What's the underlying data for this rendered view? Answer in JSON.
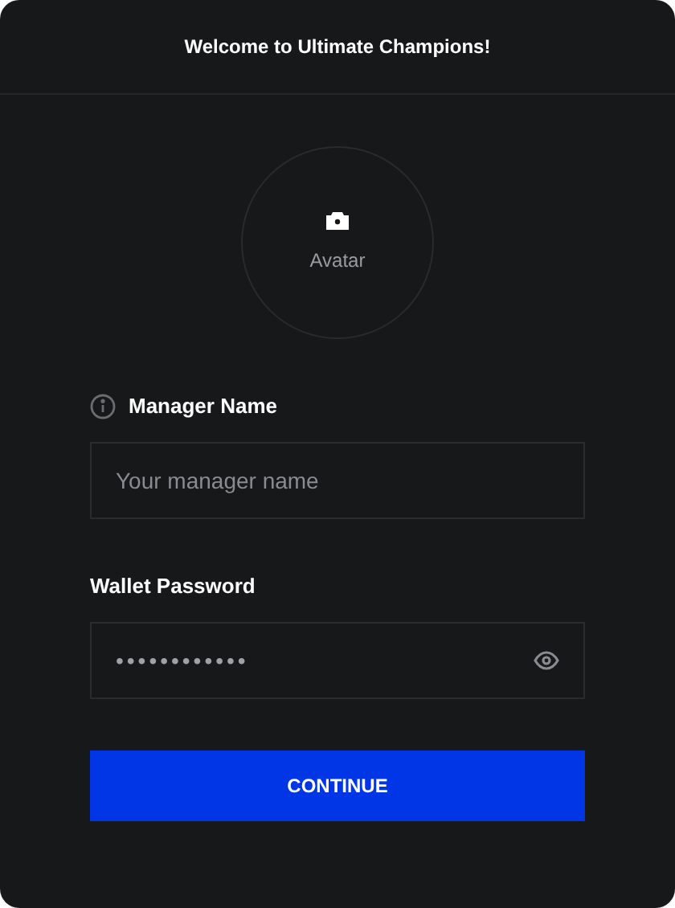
{
  "window": {
    "title": "Welcome to Ultimate Champions!"
  },
  "avatar": {
    "label": "Avatar"
  },
  "fields": [
    {
      "kind": "text",
      "label": "Manager Name",
      "info": true,
      "placeholder": "Your manager name"
    },
    {
      "kind": "password",
      "label": "Wallet Password",
      "info": false,
      "value": "••••••••••••"
    }
  ],
  "buttons": [
    "CONTINUE"
  ]
}
